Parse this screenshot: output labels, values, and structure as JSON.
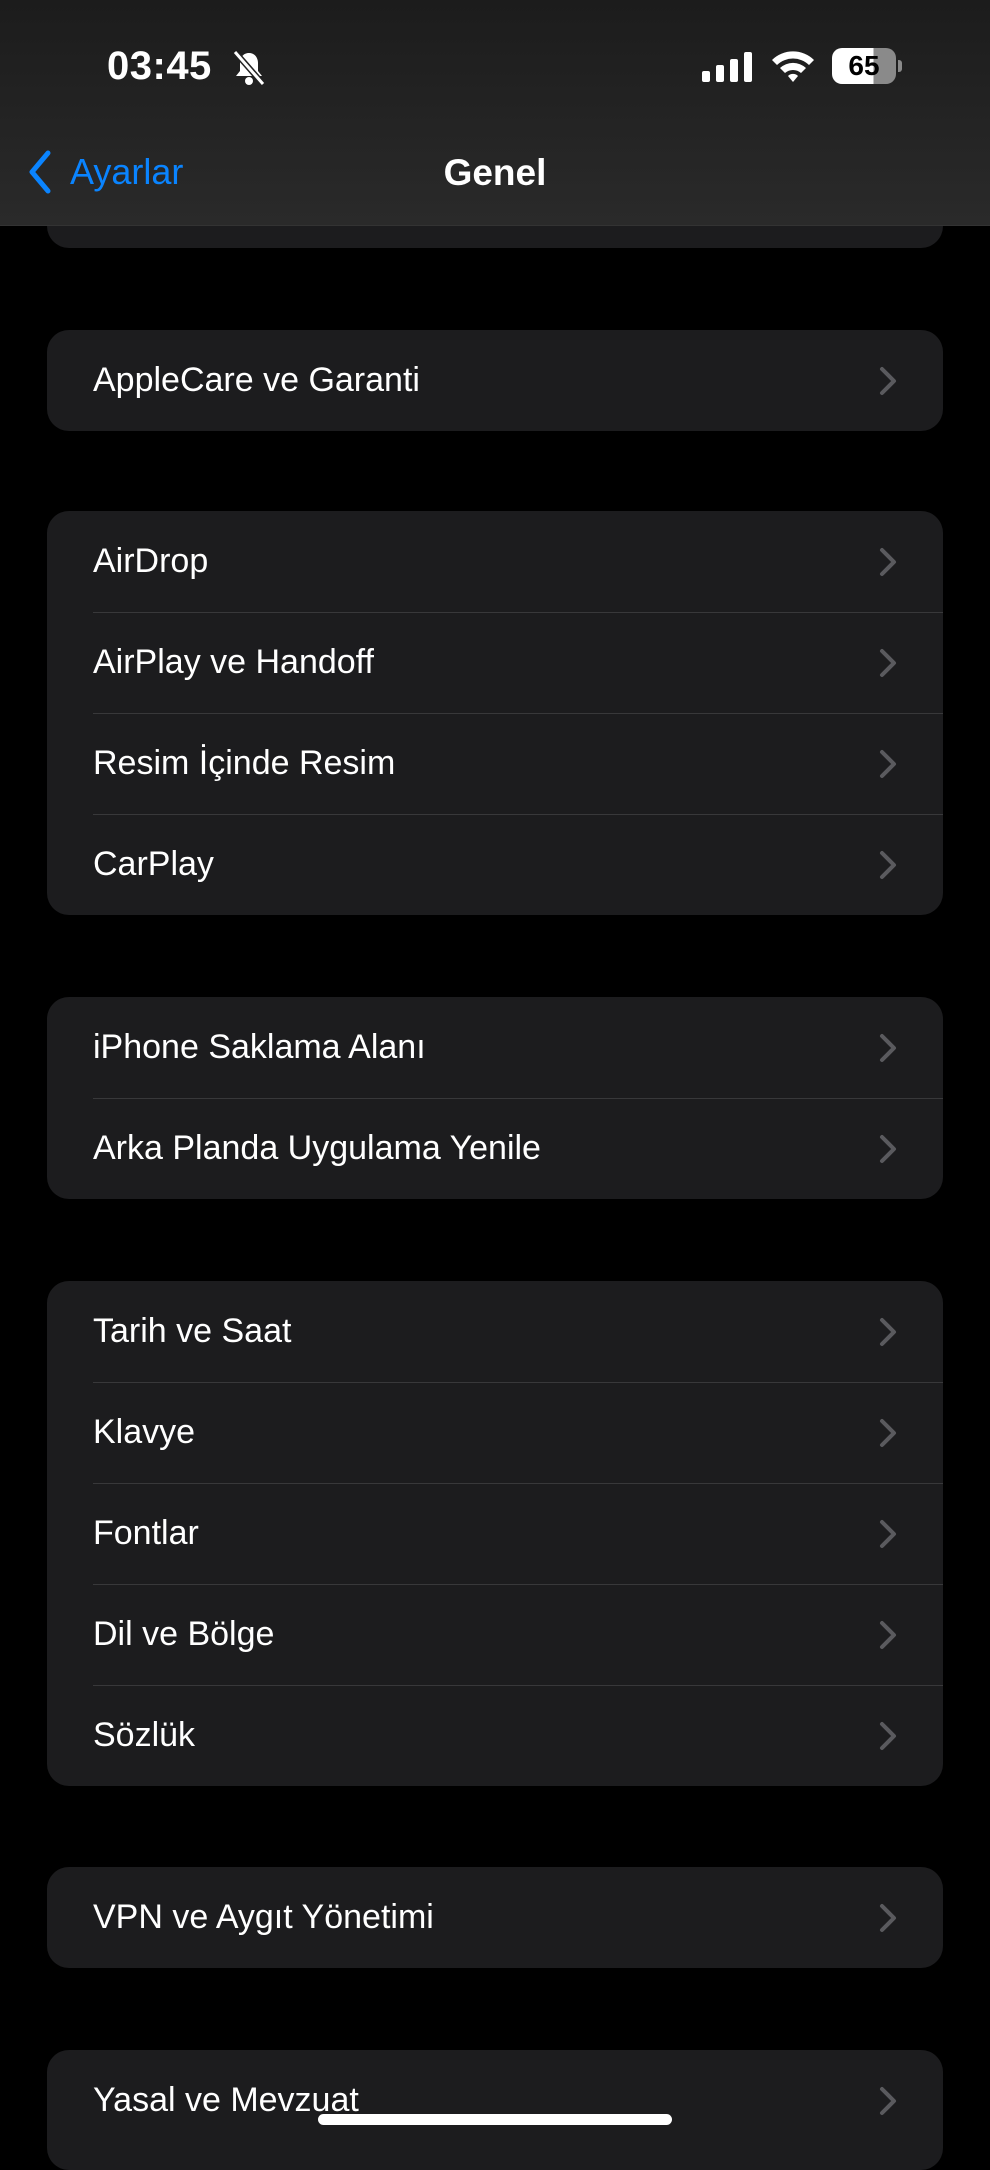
{
  "status_bar": {
    "time": "03:45",
    "battery": "65",
    "icons": [
      "bell-slash-icon",
      "cellular-signal-icon",
      "wifi-icon",
      "battery-icon"
    ]
  },
  "nav": {
    "back_label": "Ayarlar",
    "title": "Genel"
  },
  "groups": [
    {
      "items": [
        {
          "label": "AppleCare ve Garanti"
        }
      ]
    },
    {
      "items": [
        {
          "label": "AirDrop"
        },
        {
          "label": "AirPlay ve Handoff"
        },
        {
          "label": "Resim İçinde Resim"
        },
        {
          "label": "CarPlay"
        }
      ]
    },
    {
      "items": [
        {
          "label": "iPhone Saklama Alanı"
        },
        {
          "label": "Arka Planda Uygulama Yenile"
        }
      ]
    },
    {
      "items": [
        {
          "label": "Tarih ve Saat"
        },
        {
          "label": "Klavye"
        },
        {
          "label": "Fontlar"
        },
        {
          "label": "Dil ve Bölge"
        },
        {
          "label": "Sözlük"
        }
      ]
    },
    {
      "items": [
        {
          "label": "VPN ve Aygıt Yönetimi"
        }
      ]
    },
    {
      "items": [
        {
          "label": "Yasal ve Mevzuat"
        }
      ]
    }
  ],
  "colors": {
    "accent": "#0a84ff",
    "background": "#000000",
    "card": "#1c1c1e",
    "separator": "#38383a"
  }
}
